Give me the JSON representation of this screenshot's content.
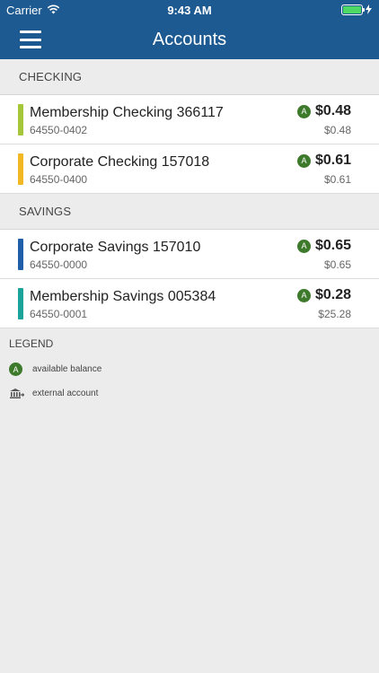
{
  "status_bar": {
    "carrier": "Carrier",
    "time": "9:43 AM"
  },
  "header": {
    "title": "Accounts"
  },
  "sections": [
    {
      "title": "CHECKING",
      "accounts": [
        {
          "name": "Membership Checking 366117",
          "number": "64550-0402",
          "badge": "A",
          "available": "$0.48",
          "current": "$0.48",
          "color": "#a6c63a"
        },
        {
          "name": "Corporate Checking 157018",
          "number": "64550-0400",
          "badge": "A",
          "available": "$0.61",
          "current": "$0.61",
          "color": "#f2b824"
        }
      ]
    },
    {
      "title": "SAVINGS",
      "accounts": [
        {
          "name": "Corporate Savings 157010",
          "number": "64550-0000",
          "badge": "A",
          "available": "$0.65",
          "current": "$0.65",
          "color": "#1f5ea8"
        },
        {
          "name": "Membership Savings 005384",
          "number": "64550-0001",
          "badge": "A",
          "available": "$0.28",
          "current": "$25.28",
          "color": "#1aa39a"
        }
      ]
    }
  ],
  "legend": {
    "title": "LEGEND",
    "items": [
      {
        "badge": "A",
        "label": "available balance"
      },
      {
        "icon": "bank-icon",
        "label": "external account"
      }
    ]
  },
  "colors": {
    "header": "#1d5a91",
    "badge": "#3e7a2b",
    "background": "#ececec"
  }
}
